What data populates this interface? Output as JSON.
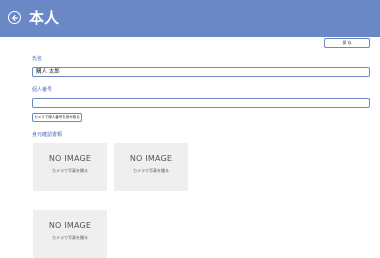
{
  "header": {
    "title": "本人"
  },
  "toolbar": {
    "save_label": "保 存"
  },
  "form": {
    "name_label": "氏名",
    "name_value": "購人 太郎",
    "number_label": "個人番号",
    "number_value": "",
    "camera_number_button": "カメラで個人番号を読み取る",
    "id_label": "身元確認書類"
  },
  "photos": [
    {
      "title": "NO IMAGE",
      "caption": "カメラで写真を撮る"
    },
    {
      "title": "NO IMAGE",
      "caption": "カメラで写真を撮る"
    },
    {
      "title": "NO IMAGE",
      "caption": "カメラで写真を撮る"
    }
  ],
  "colors": {
    "header": "#6b88c6",
    "label": "#4a6fb5",
    "placeholder_bg": "#efefef"
  },
  "icons": {
    "back": "circle-arrow-left-icon"
  }
}
